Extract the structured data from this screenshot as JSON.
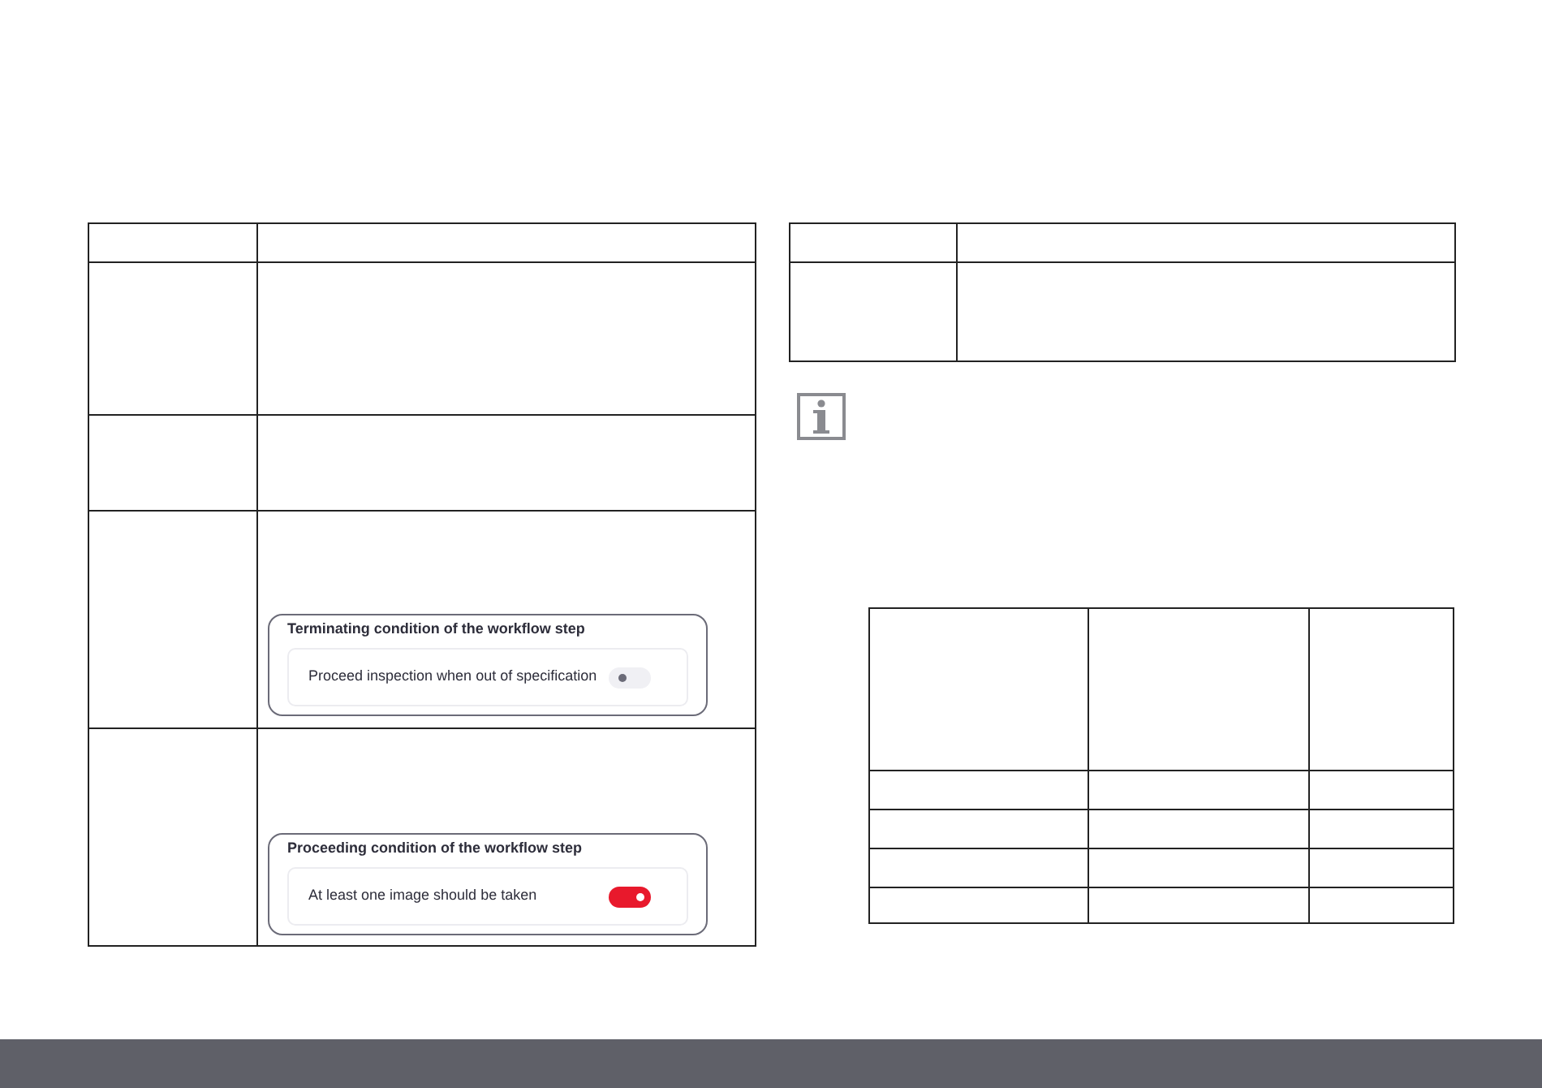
{
  "condition_panels": [
    {
      "title": "Terminating condition of the workflow step",
      "option": "Proceed inspection when out of specification",
      "on": false
    },
    {
      "title": "Proceeding condition of the workflow step",
      "option": "At least one image should be taken",
      "on": true
    }
  ]
}
